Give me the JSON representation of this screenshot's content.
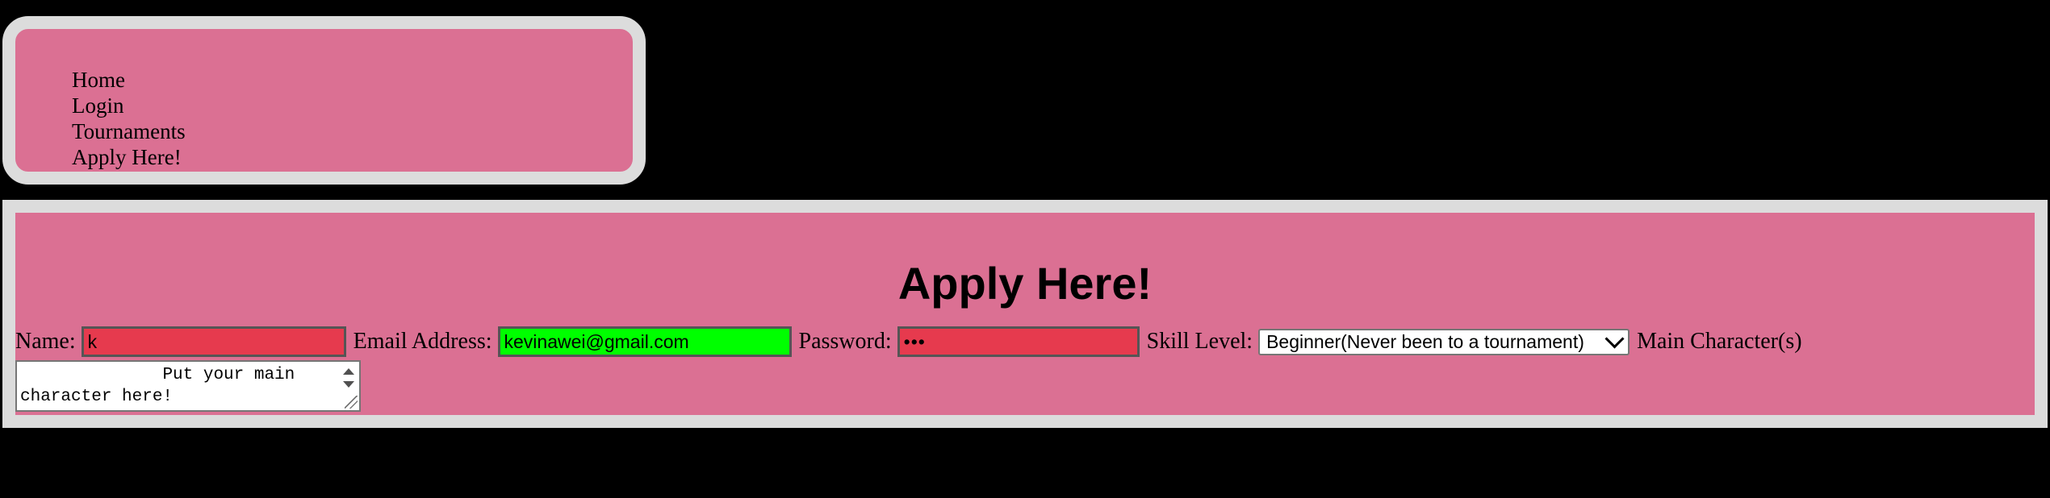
{
  "nav": {
    "items": [
      {
        "label": "Home"
      },
      {
        "label": "Login"
      },
      {
        "label": "Tournaments"
      },
      {
        "label": "Apply Here!"
      }
    ]
  },
  "main": {
    "title": "Apply Here!",
    "form": {
      "name_label": "Name:",
      "name_value": "k",
      "email_label": "Email Address:",
      "email_value": "kevinawei@gmail.com",
      "password_label": "Password:",
      "password_display": "•••",
      "skill_label": "Skill Level:",
      "skill_selected": "Beginner(Never been to a tournament)",
      "main_char_label": "Main Character(s)",
      "main_char_text": "              Put your main character here!"
    }
  },
  "colors": {
    "page_bg": "#000000",
    "panel_bg": "#db7093",
    "panel_border": "#dcdcdc",
    "invalid_field": "#e63a4e",
    "valid_field": "#00ff00"
  },
  "icons": [
    "chevron-down-icon",
    "scroll-up-icon",
    "scroll-down-icon",
    "resize-handle-icon"
  ]
}
